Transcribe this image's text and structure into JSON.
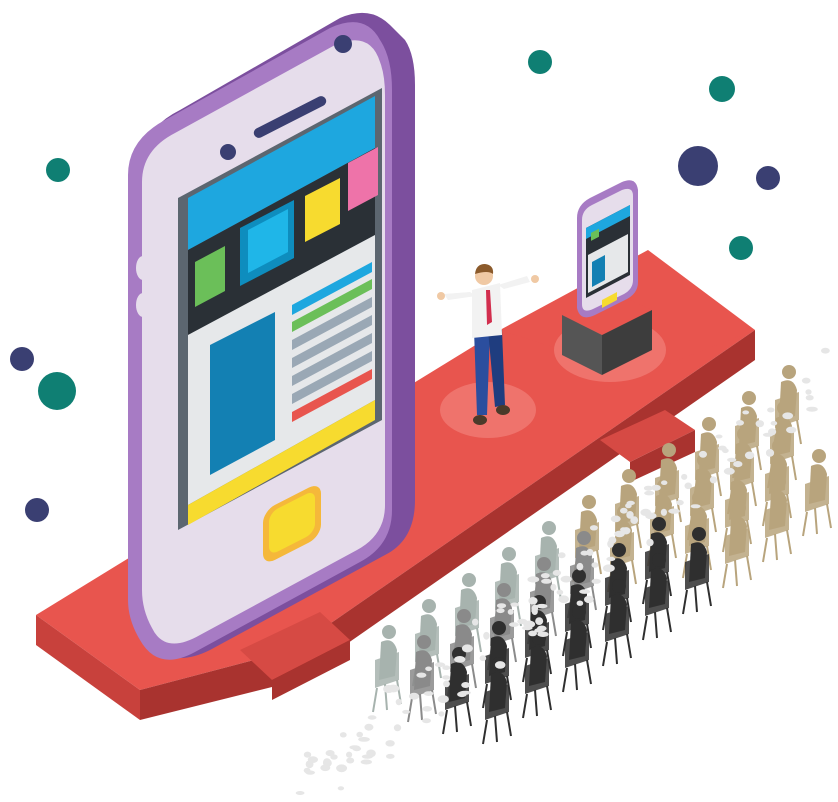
{
  "scene": {
    "colors": {
      "stage_top": "#E8554E",
      "stage_side": "#C8413C",
      "phone_body": "#A77BC4",
      "phone_edge": "#7C4F9E",
      "phone_face": "#E6DDEB",
      "screen_blue": "#1EA7DF",
      "screen_dark": "#2A3036",
      "tile_green": "#6BBF59",
      "tile_yellow": "#F7DB2F",
      "tile_pink": "#EE73A9",
      "tile_cyan": "#1FB6E8",
      "dot_teal": "#0F7F73",
      "dot_navy": "#3A3F72",
      "audience_dark": "#2F2F2F",
      "audience_gray": "#8A8A8A",
      "audience_tan": "#B8A47D",
      "audience_light": "#A7B3AE"
    },
    "icons": [
      "smartphone-icon",
      "presenter-figure",
      "audience-crowd"
    ]
  }
}
